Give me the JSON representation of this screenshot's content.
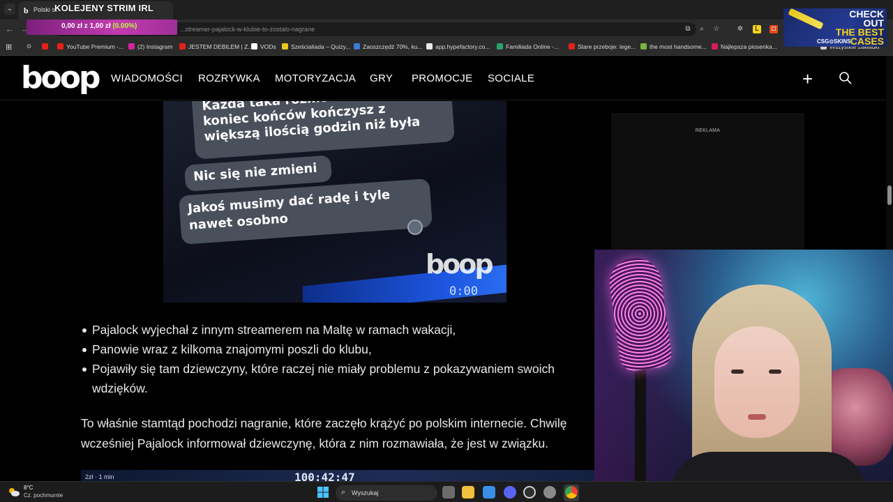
{
  "browser": {
    "tab_title": "Polski st",
    "overlay_title": "KOLEJENY STRIM IRL",
    "url": "...streamer-pajalock-w-klubie-to-zostalo-nagrane",
    "bookmarks": [
      {
        "label": "YouTube Premium -...",
        "color": "#e62117"
      },
      {
        "label": "(2) Instagram",
        "color": "#d6249f"
      },
      {
        "label": "JESTEM DEBILEM | Z...",
        "color": "#e62117"
      },
      {
        "label": "VODs",
        "color": "#ffffff"
      },
      {
        "label": "Sześcialiada – Quizy...",
        "color": "#e8c81e"
      },
      {
        "label": "Zaoszczędź 70%, ku...",
        "color": "#3a7bd5"
      },
      {
        "label": "app.hypefactory.co...",
        "color": "#e8e8e8"
      },
      {
        "label": "Familiada Online -...",
        "color": "#2aa36a"
      },
      {
        "label": "Stare przeboje: lege...",
        "color": "#e62117"
      },
      {
        "label": "the most handsome...",
        "color": "#7cb342"
      },
      {
        "label": "Najlepsza piosenka...",
        "color": "#d81b60"
      },
      {
        "label": "Wszystkie zakładki",
        "color": "#cfcfcf"
      }
    ]
  },
  "donation": {
    "amount": "0,00 zł z 1,00 zł ",
    "percent": "(0.00%)"
  },
  "site": {
    "logo": "boop",
    "nav": [
      "WIADOMOŚCI",
      "ROZRYWKA",
      "MOTORYZACJA",
      "GRY",
      "PROMOCJE",
      "SOCIALE"
    ],
    "plus": "+"
  },
  "article_image": {
    "bubble1": "Każda taka rozmo… bezcelowa bo koniec końców kończysz z większą ilością godzin niż była",
    "bubble2": "Nic się nie zmieni",
    "bubble3": "Jakoś musimy dać radę i tyle nawet osobno",
    "watermark": "boop",
    "audio_time": "0:00"
  },
  "article": {
    "bullets": [
      "Pajalock wyjechał z innym streamerem na Maltę w ramach wakacji,",
      "Panowie wraz z kilkoma znajomymi poszli do klubu,",
      "Pojawiły się tam dziewczyny, które raczej nie miały problemu z pokazywaniem swoich wdzięków."
    ],
    "paragraph": "To właśnie stamtąd pochodzi nagranie, które zaczęło krążyć po polskim internecie. Chwilę wcześniej Pajalock informował dziewczynę, która z nim rozmawiała, że jest w związku.",
    "next_image_caption": "2zł · 1 min",
    "next_image_time": "100:42:47"
  },
  "sidebar": {
    "ad_label": "REKLAMA"
  },
  "promo": {
    "line1": "CHECK OUT",
    "line2": "THE BEST",
    "line3": "CASES",
    "brand": "CSG⊙SKINS"
  },
  "taskbar": {
    "temperature": "8°C",
    "weather": "Cz. pochmurnie",
    "search_placeholder": "Wyszukaj"
  }
}
